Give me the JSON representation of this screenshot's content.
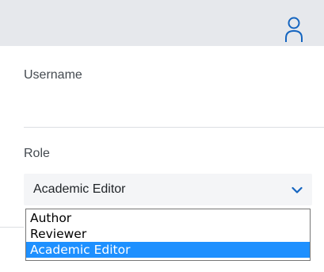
{
  "form": {
    "username_label": "Username",
    "role_label": "Role",
    "role_value": "Academic Editor"
  },
  "dropdown": {
    "options": [
      "Author",
      "Reviewer",
      "Academic Editor"
    ],
    "selected_index": 2
  },
  "icons": {
    "user": "user-icon",
    "chevron": "chevron-down-icon"
  },
  "colors": {
    "topbar_bg": "#e6e8ec",
    "accent": "#1565c0",
    "selection": "#1e90ff"
  }
}
